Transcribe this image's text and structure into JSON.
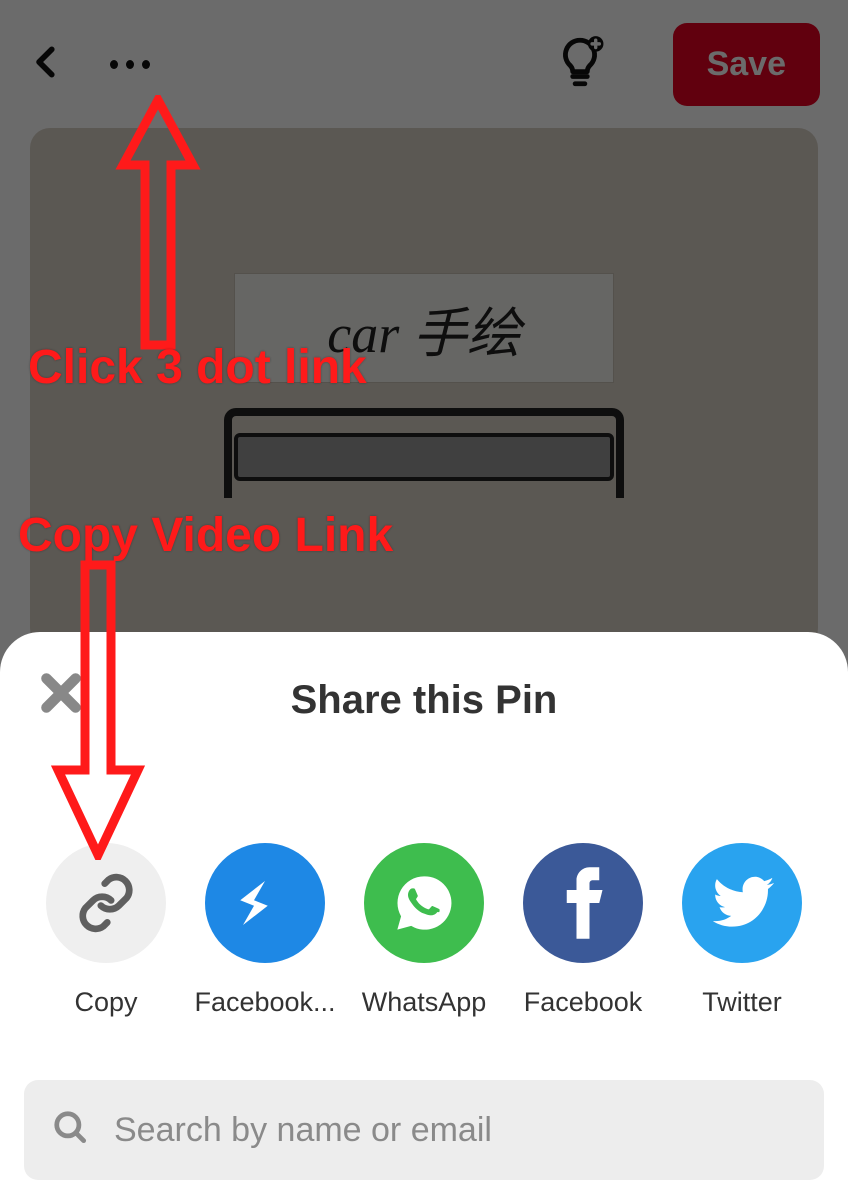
{
  "header": {
    "save_label": "Save"
  },
  "content": {
    "label_text": "car 手绘"
  },
  "sheet": {
    "title": "Share this Pin",
    "items": [
      {
        "label": "Copy"
      },
      {
        "label": "Facebook..."
      },
      {
        "label": "WhatsApp"
      },
      {
        "label": "Facebook"
      },
      {
        "label": "Twitter"
      }
    ],
    "search_placeholder": "Search by name or email"
  },
  "annotations": {
    "top_label": "Click 3 dot link",
    "bottom_label": "Copy Video Link"
  },
  "colors": {
    "accent_red": "#e60023",
    "annotation_red": "#ff1a1a",
    "messenger": "#1e88e5",
    "whatsapp": "#3ebd4e",
    "facebook": "#3b5998",
    "twitter": "#29a3ef"
  }
}
